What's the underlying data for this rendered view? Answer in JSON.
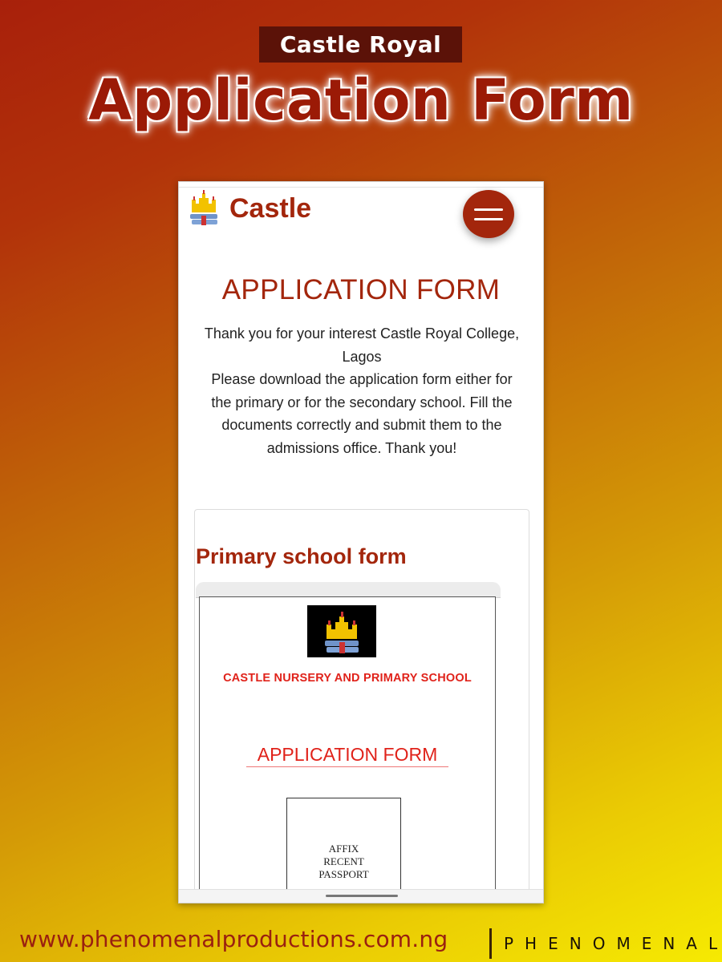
{
  "banner": {
    "badge": "Castle Royal",
    "title": "Application Form"
  },
  "phone": {
    "brand": "Castle",
    "page_heading": "APPLICATION FORM",
    "intro_lines": [
      "Thank you for your interest Castle Royal College,",
      "Lagos",
      "Please download the application form either for",
      "the primary or for the secondary school. Fill the",
      "documents correctly and submit them to the",
      "admissions office. Thank you!"
    ],
    "card": {
      "title": "Primary school form",
      "document": {
        "school_name": "CASTLE NURSERY AND PRIMARY SCHOOL",
        "form_title": "APPLICATION FORM",
        "passport_lines": [
          "AFFIX",
          "RECENT",
          "PASSPORT"
        ]
      }
    }
  },
  "footer": {
    "url": "www.phenomenalproductions.com.ng",
    "brand": "PHENOMENAL"
  },
  "colors": {
    "brand_red": "#a3260c",
    "doc_red": "#e0221a",
    "badge_bg": "#5b1208"
  }
}
